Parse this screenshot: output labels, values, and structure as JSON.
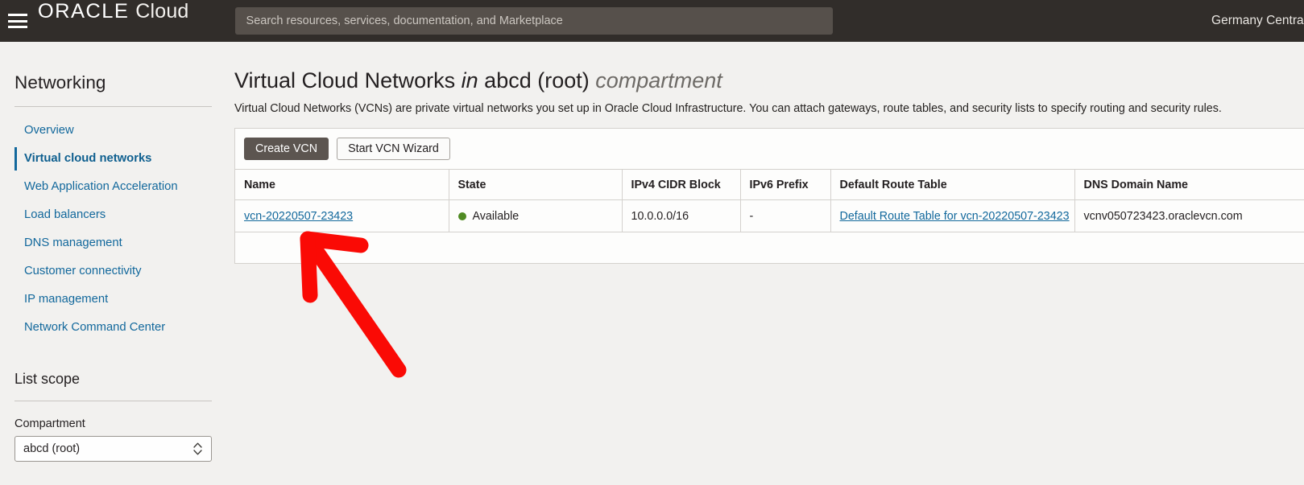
{
  "topbar": {
    "menu_icon": "hamburger-icon",
    "brand_oracle": "ORACLE",
    "brand_cloud": "Cloud",
    "search_placeholder": "Search resources, services, documentation, and Marketplace",
    "search_value": "",
    "region": "Germany Central (F"
  },
  "sidebar": {
    "title": "Networking",
    "items": [
      {
        "label": "Overview",
        "active": false
      },
      {
        "label": "Virtual cloud networks",
        "active": true
      },
      {
        "label": "Web Application Acceleration",
        "active": false
      },
      {
        "label": "Load balancers",
        "active": false
      },
      {
        "label": "DNS management",
        "active": false
      },
      {
        "label": "Customer connectivity",
        "active": false
      },
      {
        "label": "IP management",
        "active": false
      },
      {
        "label": "Network Command Center",
        "active": false
      }
    ],
    "list_scope_title": "List scope",
    "compartment_label": "Compartment",
    "compartment_value": "abcd (root)"
  },
  "main": {
    "title_main": "Virtual Cloud Networks",
    "title_in": "in",
    "title_compartment": "abcd (root)",
    "title_suffix": "compartment",
    "description": "Virtual Cloud Networks (VCNs) are private virtual networks you set up in Oracle Cloud Infrastructure. You can attach gateways, route tables, and security lists to specify routing and security rules.",
    "create_button": "Create VCN",
    "wizard_button": "Start VCN Wizard",
    "table": {
      "headers": [
        "Name",
        "State",
        "IPv4 CIDR Block",
        "IPv6 Prefix",
        "Default Route Table",
        "DNS Domain Name"
      ],
      "rows": [
        {
          "name": "vcn-20220507-23423",
          "state": "Available",
          "state_color": "#4f8a22",
          "ipv4_cidr": "10.0.0.0/16",
          "ipv6_prefix": "-",
          "default_route_table": "Default Route Table for vcn-20220507-23423",
          "dns_domain_name": "vcnv050723423.oraclevcn.com"
        }
      ]
    }
  },
  "annotation": {
    "arrow_color": "#fa0a05",
    "arrow_description": "red-arrow-pointing-at-vcn-name-link"
  },
  "colors": {
    "topbar_bg": "#312d2a",
    "page_bg": "#f2f1ef",
    "link": "#12689c",
    "accent": "#12689c",
    "button_primary_bg": "#5c5550"
  }
}
